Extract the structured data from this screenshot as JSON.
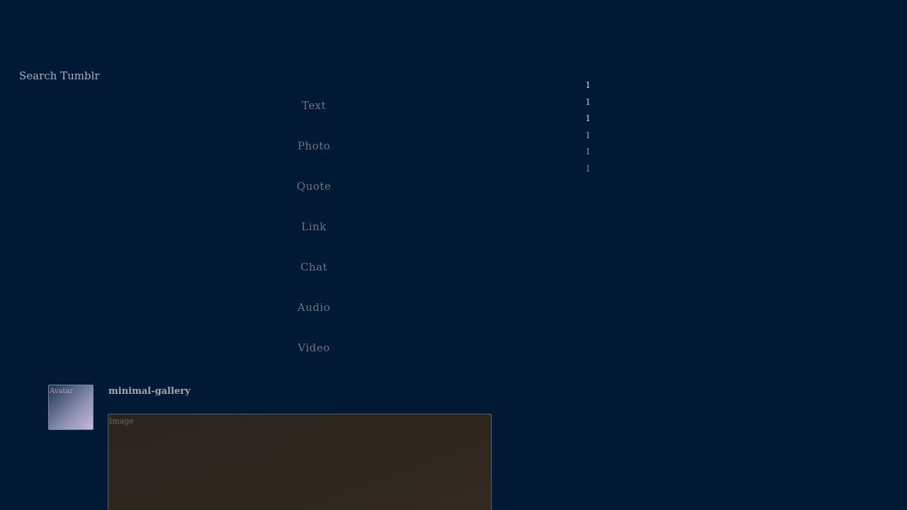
{
  "search": {
    "label": "Search Tumblr"
  },
  "post_types": [
    {
      "label": "Text"
    },
    {
      "label": "Photo"
    },
    {
      "label": "Quote"
    },
    {
      "label": "Link"
    },
    {
      "label": "Chat"
    },
    {
      "label": "Audio"
    },
    {
      "label": "Video"
    }
  ],
  "counts": [
    {
      "value": "1",
      "color": "#d8dde4"
    },
    {
      "value": "1",
      "color": "#c8ced6"
    },
    {
      "value": "1",
      "color": "#d0d6de"
    },
    {
      "value": "1",
      "color": "#9aa3ae"
    },
    {
      "value": "1",
      "color": "#8a939e"
    },
    {
      "value": "1",
      "color": "#7e8792"
    }
  ],
  "post": {
    "avatar_alt": "Avatar",
    "blog_name": "minimal-gallery",
    "image_alt": "Image"
  }
}
